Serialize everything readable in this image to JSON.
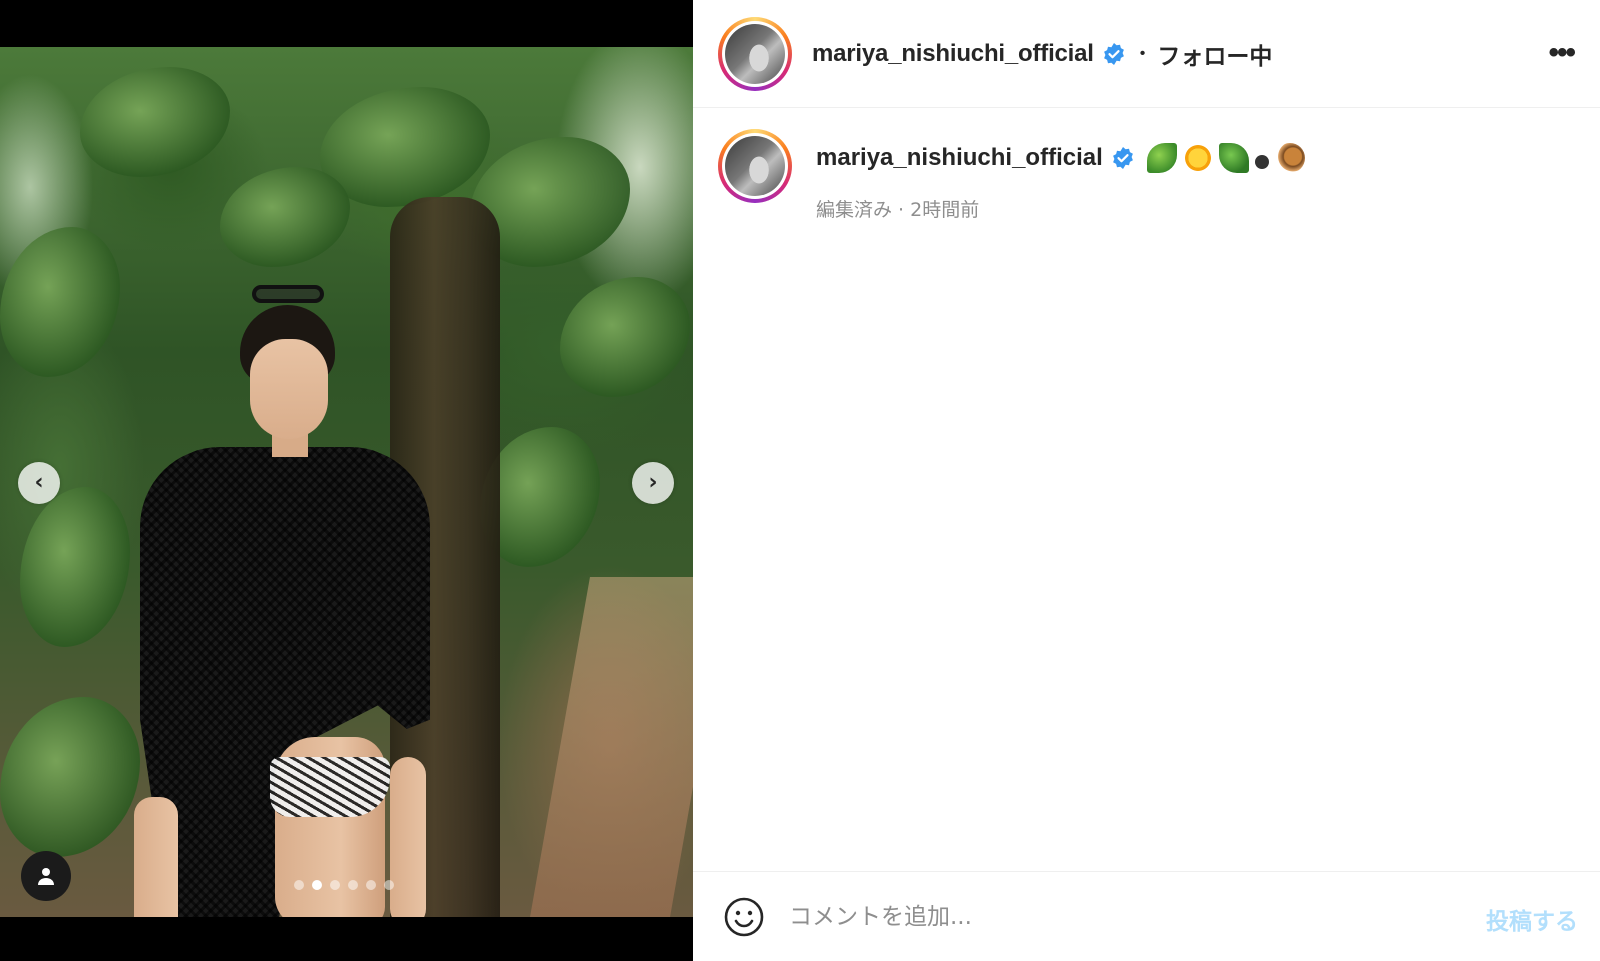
{
  "post": {
    "username": "mariya_nishiuchi_official",
    "follow_status": "フォロー中",
    "header_separator": "•",
    "more_label": "•••",
    "caption": {
      "username": "mariya_nishiuchi_official",
      "emojis": [
        "leaf-emoji",
        "sun-emoji",
        "leaf-emoji",
        "bug-emoji",
        "snail-emoji"
      ],
      "meta": "編集済み · 2時間前"
    },
    "carousel": {
      "slide_count": 6,
      "active_index": 1
    }
  },
  "comment": {
    "placeholder": "コメントを追加...",
    "submit_label": "投稿する"
  },
  "colors": {
    "verified": "#3897f0",
    "submit_disabled": "#b2dffc",
    "meta_text": "#8e8e8e"
  }
}
